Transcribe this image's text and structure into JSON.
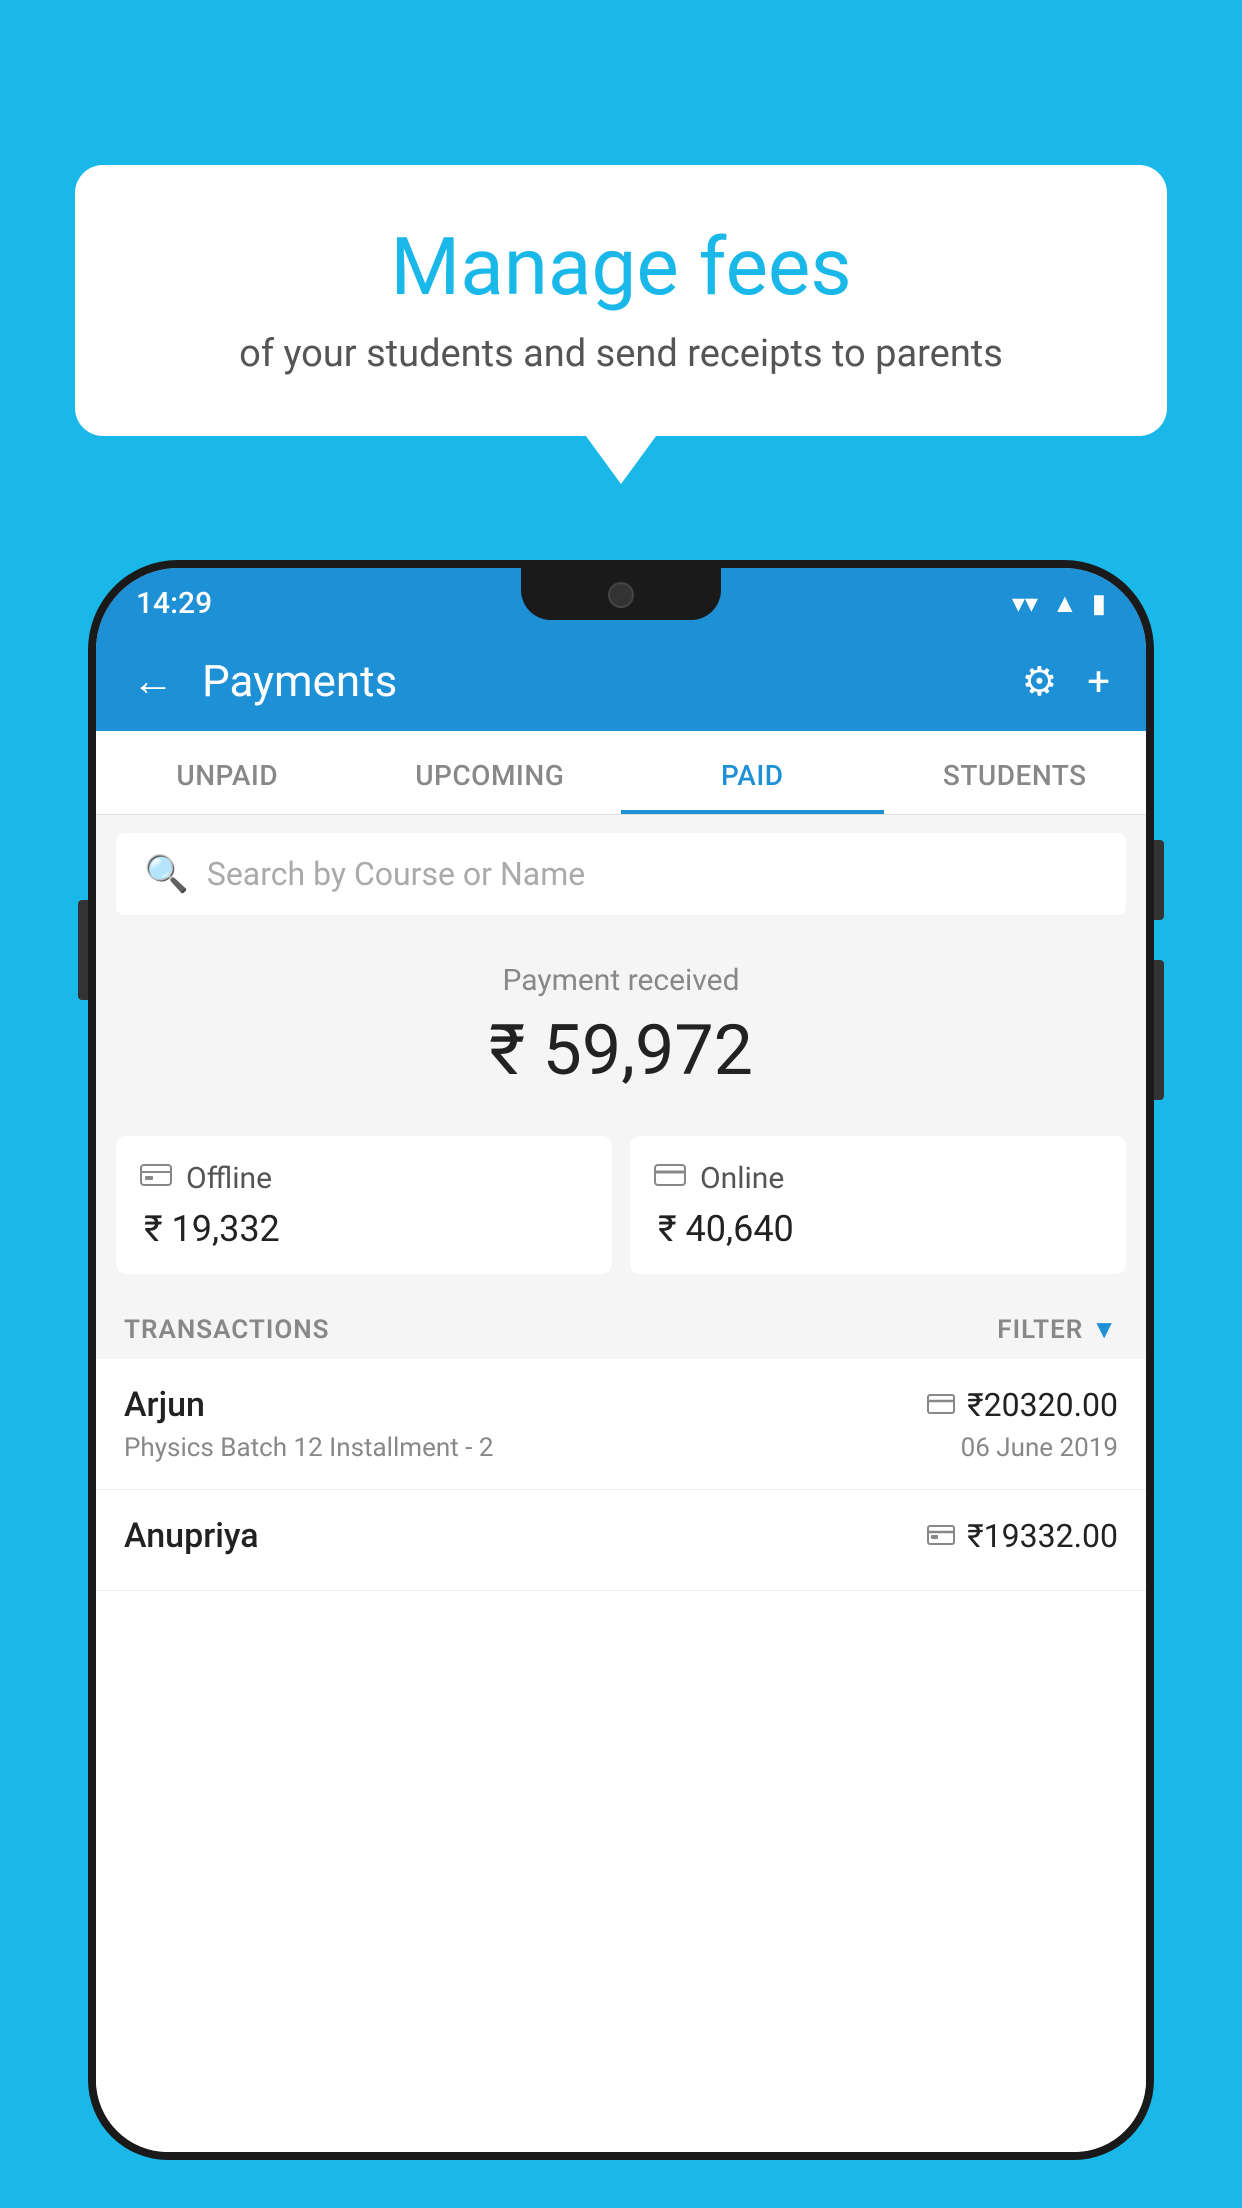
{
  "background_color": "#1ab8e8",
  "speech_bubble": {
    "title": "Manage fees",
    "subtitle": "of your students and send receipts to parents"
  },
  "status_bar": {
    "time": "14:29",
    "icons": [
      "wifi",
      "signal",
      "battery"
    ]
  },
  "app_bar": {
    "title": "Payments",
    "back_label": "←",
    "gear_label": "⚙",
    "plus_label": "+"
  },
  "tabs": [
    {
      "label": "UNPAID",
      "active": false
    },
    {
      "label": "UPCOMING",
      "active": false
    },
    {
      "label": "PAID",
      "active": true
    },
    {
      "label": "STUDENTS",
      "active": false
    }
  ],
  "search": {
    "placeholder": "Search by Course or Name"
  },
  "payment_summary": {
    "label": "Payment received",
    "amount": "₹ 59,972",
    "offline": {
      "label": "Offline",
      "amount": "₹ 19,332",
      "icon": "💳"
    },
    "online": {
      "label": "Online",
      "amount": "₹ 40,640",
      "icon": "💳"
    }
  },
  "transactions_section": {
    "label": "TRANSACTIONS",
    "filter_label": "FILTER"
  },
  "transactions": [
    {
      "name": "Arjun",
      "detail": "Physics Batch 12 Installment - 2",
      "amount": "₹20320.00",
      "date": "06 June 2019",
      "payment_mode": "online"
    },
    {
      "name": "Anupriya",
      "detail": "",
      "amount": "₹19332.00",
      "date": "",
      "payment_mode": "offline"
    }
  ]
}
